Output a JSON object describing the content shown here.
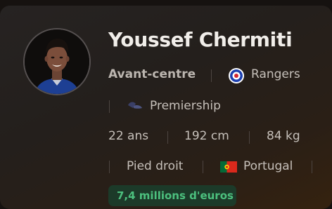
{
  "player": {
    "name": "Youssef Chermiti",
    "position": "Avant-centre",
    "club": "Rangers",
    "league": "Premiership",
    "age": "22 ans",
    "height": "192 cm",
    "weight": "84 kg",
    "foot": "Pied droit",
    "nationality": "Portugal",
    "market_value": "7,4 millions d'euros"
  },
  "icons": {
    "avatar": "player-photo",
    "club": "rangers-crest-icon",
    "league": "premiership-logo-icon",
    "nationality": "portugal-flag-icon"
  },
  "colors": {
    "accent_value": "#4cc07e",
    "club_blue": "#1b3fb0"
  }
}
